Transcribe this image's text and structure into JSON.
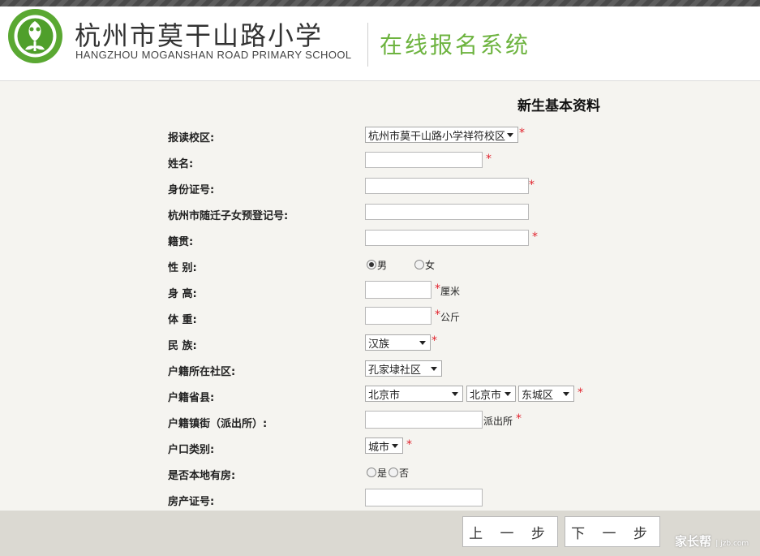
{
  "header": {
    "school_name_cn": "杭州市莫干山路小学",
    "school_name_en": "HANGZHOU MOGANSHAN ROAD PRIMARY SCHOOL",
    "system_name": "在线报名系统"
  },
  "page_title": "新生基本资料",
  "form": {
    "campus": {
      "label": "报读校区:",
      "value": "杭州市莫干山路小学祥符校区"
    },
    "name": {
      "label": "姓名:",
      "value": ""
    },
    "id_number": {
      "label": "身份证号:",
      "value": ""
    },
    "migrant_reg": {
      "label": "杭州市随迁子女预登记号:",
      "value": ""
    },
    "native_place": {
      "label": "籍贯:",
      "value": ""
    },
    "gender": {
      "label": "性 别:",
      "options": [
        "男",
        "女"
      ],
      "selected": "男"
    },
    "height": {
      "label": "身 高:",
      "value": "",
      "unit": "厘米"
    },
    "weight": {
      "label": "体 重:",
      "value": "",
      "unit": "公斤"
    },
    "ethnicity": {
      "label": "民 族:",
      "value": "汉族"
    },
    "community": {
      "label": "户籍所在社区:",
      "value": "孔家埭社区"
    },
    "province_county": {
      "label": "户籍省县:",
      "province": "北京市",
      "city": "北京市",
      "district": "东城区"
    },
    "street": {
      "label": "户籍镇街（派出所）:",
      "value": "",
      "suffix": "派出所"
    },
    "hukou_type": {
      "label": "户口类别:",
      "value": "城市"
    },
    "local_house": {
      "label": "是否本地有房:",
      "options": [
        "是",
        "否"
      ],
      "selected": ""
    },
    "property_cert": {
      "label": "房产证号:",
      "value": ""
    }
  },
  "required_mark": "*",
  "buttons": {
    "prev": "上 一 步",
    "next": "下 一 步"
  },
  "watermark": {
    "brand": "家长帮",
    "domain": "jzb.com"
  },
  "colors": {
    "accent_green": "#6db33f",
    "required_red": "#e1232d"
  }
}
